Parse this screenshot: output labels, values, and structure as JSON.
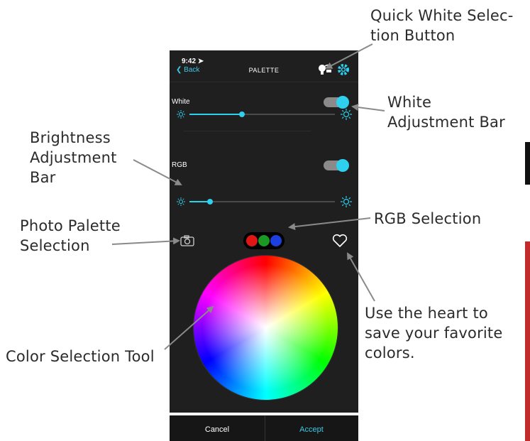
{
  "annotations": {
    "quick_white_line1": "Quick White Selec-",
    "quick_white_line2": "tion Button",
    "white_adjust_line1": "White",
    "white_adjust_line2": "Adjustment Bar",
    "brightness_line1": "Brightness",
    "brightness_line2": "Adjustment",
    "brightness_line3": "Bar",
    "photo_line1": "Photo Palette",
    "photo_line2": "Selection",
    "rgb_selection": "RGB Selection",
    "color_tool": "Color Selection Tool",
    "heart_line1": "Use the heart to",
    "heart_line2": "save your favorite",
    "heart_line3": "colors."
  },
  "phone": {
    "status_time": "9:42 ➤",
    "back_label": "❮ Back",
    "title": "PALETTE",
    "white_label": "White",
    "rgb_label": "RGB",
    "white_slider_value": 0.36,
    "rgb_slider_value": 0.14,
    "white_toggle_on": true,
    "rgb_toggle_on": true,
    "cancel_label": "Cancel",
    "accept_label": "Accept",
    "accent_color": "#2ed0ee"
  },
  "icons": [
    "bulb-icon",
    "gear-icon",
    "sun-icon",
    "camera-icon",
    "heart-icon"
  ]
}
